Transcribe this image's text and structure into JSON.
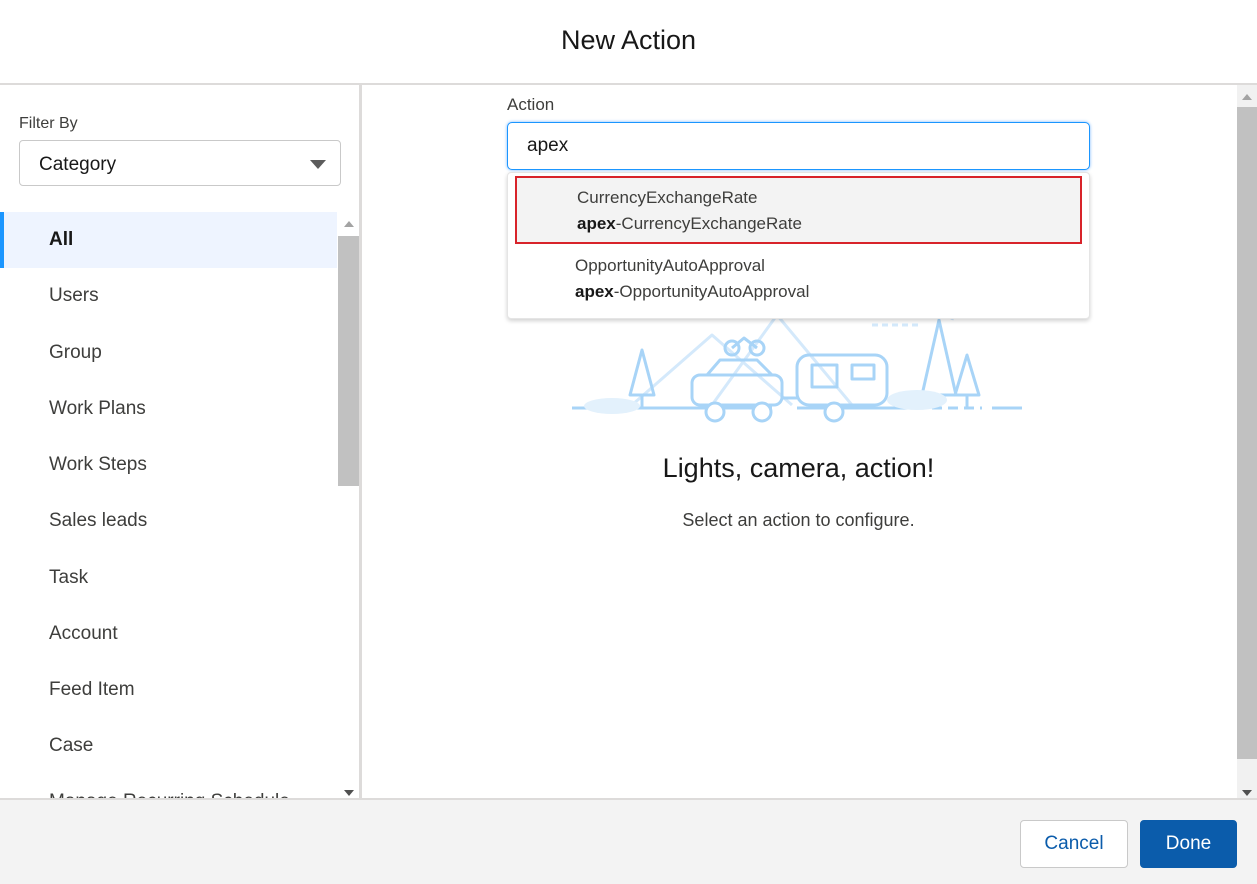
{
  "dialog": {
    "title": "New Action"
  },
  "sidebar": {
    "filter_label": "Filter By",
    "filter_value": "Category",
    "items": [
      {
        "label": "All",
        "active": true
      },
      {
        "label": "Users"
      },
      {
        "label": "Group"
      },
      {
        "label": "Work Plans"
      },
      {
        "label": "Work Steps"
      },
      {
        "label": "Sales leads"
      },
      {
        "label": "Task"
      },
      {
        "label": "Account"
      },
      {
        "label": "Feed Item"
      },
      {
        "label": "Case"
      },
      {
        "label": "Manage Recurring Schedule"
      }
    ]
  },
  "main": {
    "action_label": "Action",
    "search_value": "apex",
    "results": [
      {
        "title": "CurrencyExchangeRate",
        "prefix": "apex",
        "suffix": "-CurrencyExchangeRate",
        "highlighted": true
      },
      {
        "title": "OpportunityAutoApproval",
        "prefix": "apex",
        "suffix": "-OpportunityAutoApproval"
      }
    ],
    "empty_title": "Lights, camera, action!",
    "empty_subtitle": "Select an action to configure."
  },
  "footer": {
    "cancel_label": "Cancel",
    "done_label": "Done"
  },
  "colors": {
    "brand": "#0b5cab",
    "focus": "#1b96ff",
    "highlight_border": "#d8232a",
    "illustration": "#a8d4f7"
  }
}
